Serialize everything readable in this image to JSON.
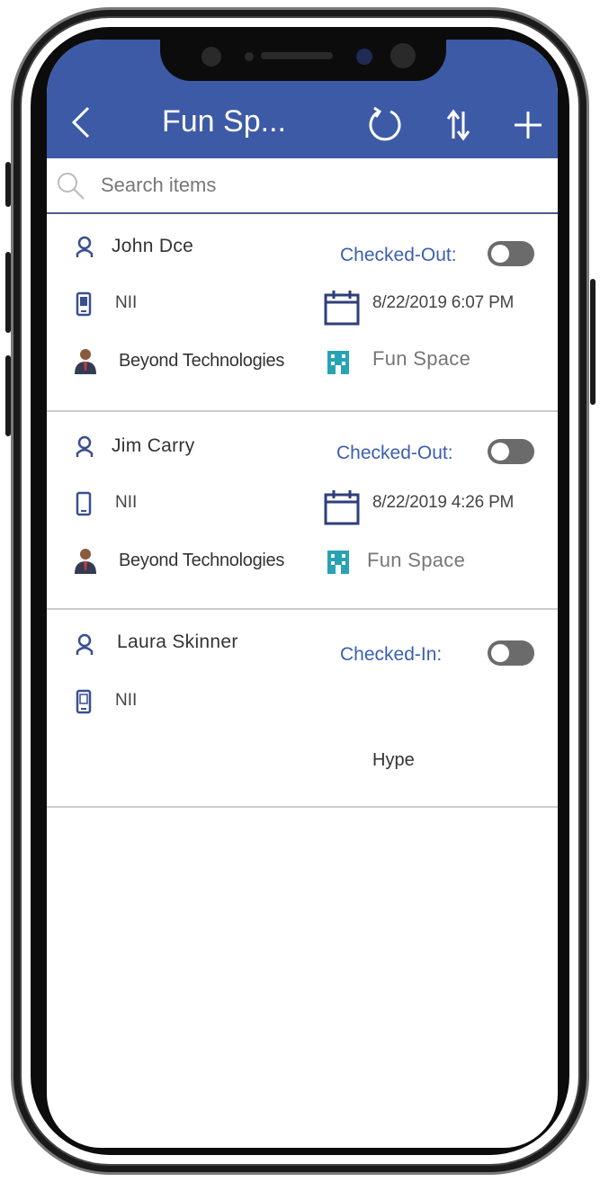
{
  "header": {
    "title": "Fun Sp..."
  },
  "search": {
    "placeholder": "Search items"
  },
  "items": [
    {
      "name": "John Dce",
      "status": "Checked-Out:",
      "device": "NII",
      "datetime": "8/22/2019 6:07 PM",
      "company": "Beyond Technologies",
      "space": "Fun Space"
    },
    {
      "name": "Jim Carry",
      "status": "Checked-Out:",
      "device": "NII",
      "datetime": "8/22/2019 4:26 PM",
      "company": "Beyond Technologies",
      "space": "Fun Space"
    },
    {
      "name": "Laura Skinner",
      "status": "Checked-In:",
      "device": "NII",
      "note": "Hype"
    }
  ],
  "colors": {
    "header": "#3c5aa6",
    "accent": "#3a5fb0",
    "toggle": "#6b6b6b",
    "space_icon": "#27a3b4"
  },
  "icons": [
    "back-chevron",
    "refresh",
    "sort",
    "add",
    "search",
    "person",
    "phone",
    "calendar",
    "businessman",
    "building"
  ]
}
